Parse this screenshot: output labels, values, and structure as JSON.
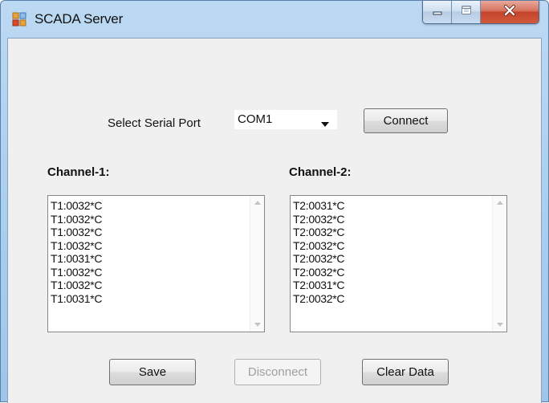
{
  "window": {
    "title": "SCADA Server",
    "controls": {
      "minimize": "minimize",
      "maximize": "maximize",
      "close": "close"
    }
  },
  "serial": {
    "label": "Select Serial Port",
    "selected_port": "COM1",
    "connect_label": "Connect"
  },
  "channel1": {
    "label": "Channel-1:",
    "readings": [
      "T1:0032*C",
      "T1:0032*C",
      "T1:0032*C",
      "T1:0032*C",
      "T1:0031*C",
      "T1:0032*C",
      "T1:0032*C",
      "T1:0031*C"
    ]
  },
  "channel2": {
    "label": "Channel-2:",
    "readings": [
      "T2:0031*C",
      "T2:0032*C",
      "T2:0032*C",
      "T2:0032*C",
      "T2:0032*C",
      "T2:0032*C",
      "T2:0031*C",
      "T2:0032*C"
    ]
  },
  "actions": {
    "save_label": "Save",
    "disconnect_label": "Disconnect",
    "clear_label": "Clear Data"
  },
  "colors": {
    "titlebar": "#a8cdee",
    "client_bg": "#f0f0f0",
    "close_button": "#c3442a"
  },
  "icons": {
    "app": "app-window-icon",
    "minimize": "minimize-icon",
    "maximize": "maximize-icon",
    "close": "close-icon",
    "combo": "chevron-down-icon"
  }
}
